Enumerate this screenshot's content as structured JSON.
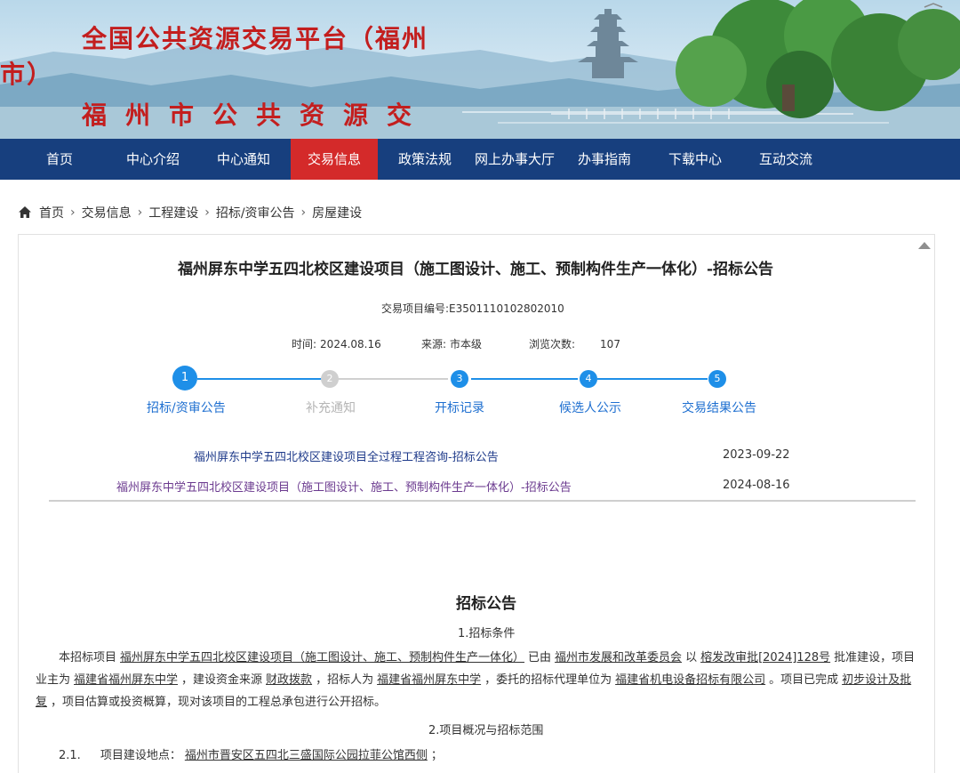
{
  "banner": {
    "title": "全国公共资源交易平台（福州市）",
    "subtitle": "福州市公共资源交易网"
  },
  "nav": {
    "items": [
      "首页",
      "中心介绍",
      "中心通知",
      "交易信息",
      "政策法规",
      "网上办事大厅",
      "办事指南",
      "下载中心",
      "互动交流"
    ],
    "active": "交易信息"
  },
  "breadcrumb": [
    "首页",
    "交易信息",
    "工程建设",
    "招标/资审公告",
    "房屋建设"
  ],
  "article": {
    "title": "福州屏东中学五四北校区建设项目（施工图设计、施工、预制构件生产一体化）-招标公告",
    "project_code_label": "交易项目编号:",
    "project_code": "E3501110102802010",
    "time_label": "时间:",
    "time": "2024.08.16",
    "source_label": "来源:",
    "source": "市本级",
    "views_label": "浏览次数:",
    "views": "107"
  },
  "steps": [
    {
      "num": "1",
      "label": "招标/资审公告",
      "state": "current"
    },
    {
      "num": "2",
      "label": "补充通知",
      "state": "disabled"
    },
    {
      "num": "3",
      "label": "开标记录",
      "state": "enabled"
    },
    {
      "num": "4",
      "label": "候选人公示",
      "state": "enabled"
    },
    {
      "num": "5",
      "label": "交易结果公告",
      "state": "enabled"
    }
  ],
  "related": [
    {
      "title": "福州屏东中学五四北校区建设项目全过程工程咨询-招标公告",
      "date": "2023-09-22"
    },
    {
      "title": "福州屏东中学五四北校区建设项目（施工图设计、施工、预制构件生产一体化）-招标公告",
      "date": "2024-08-16"
    }
  ],
  "notice": {
    "heading": "招标公告",
    "section1": "1.招标条件",
    "p1": {
      "t1": "本招标项目",
      "project_name": "福州屏东中学五四北校区建设项目（施工图设计、施工、预制构件生产一体化）",
      "t2": "已由",
      "approver": "福州市发展和改革委员会",
      "t3": "以",
      "approval_no": "榕发改审批[2024]128号",
      "t4": "批准建设，项目业主为",
      "owner": "福建省福州屏东中学",
      "t5": "，建设资金来源",
      "fund": "财政拨款",
      "t6": "，招标人为",
      "tenderer": "福建省福州屏东中学",
      "t7": "，委托的招标代理单位为",
      "agent": "福建省机电设备招标有限公司",
      "t8": "。项目已完成",
      "completed": "初步设计及批复",
      "t9": "，项目估算或投资概算，现对该项目的工程总承包进行公开招标。"
    },
    "section2": "2.项目概况与招标范围",
    "item21": {
      "num": "2.1.",
      "label": "项目建设地点：",
      "value": "福州市晋安区五四北三盛国际公园拉菲公馆西侧",
      "end": "；"
    }
  },
  "colors": {
    "nav_bg": "#173f7e",
    "nav_active": "#d42a2a",
    "banner_title": "#c31e1e",
    "step_active": "#1e8fe8",
    "step_disabled": "#cfcfcf",
    "link_blue": "#1e3a8a",
    "link_visited": "#6b3a8f"
  }
}
